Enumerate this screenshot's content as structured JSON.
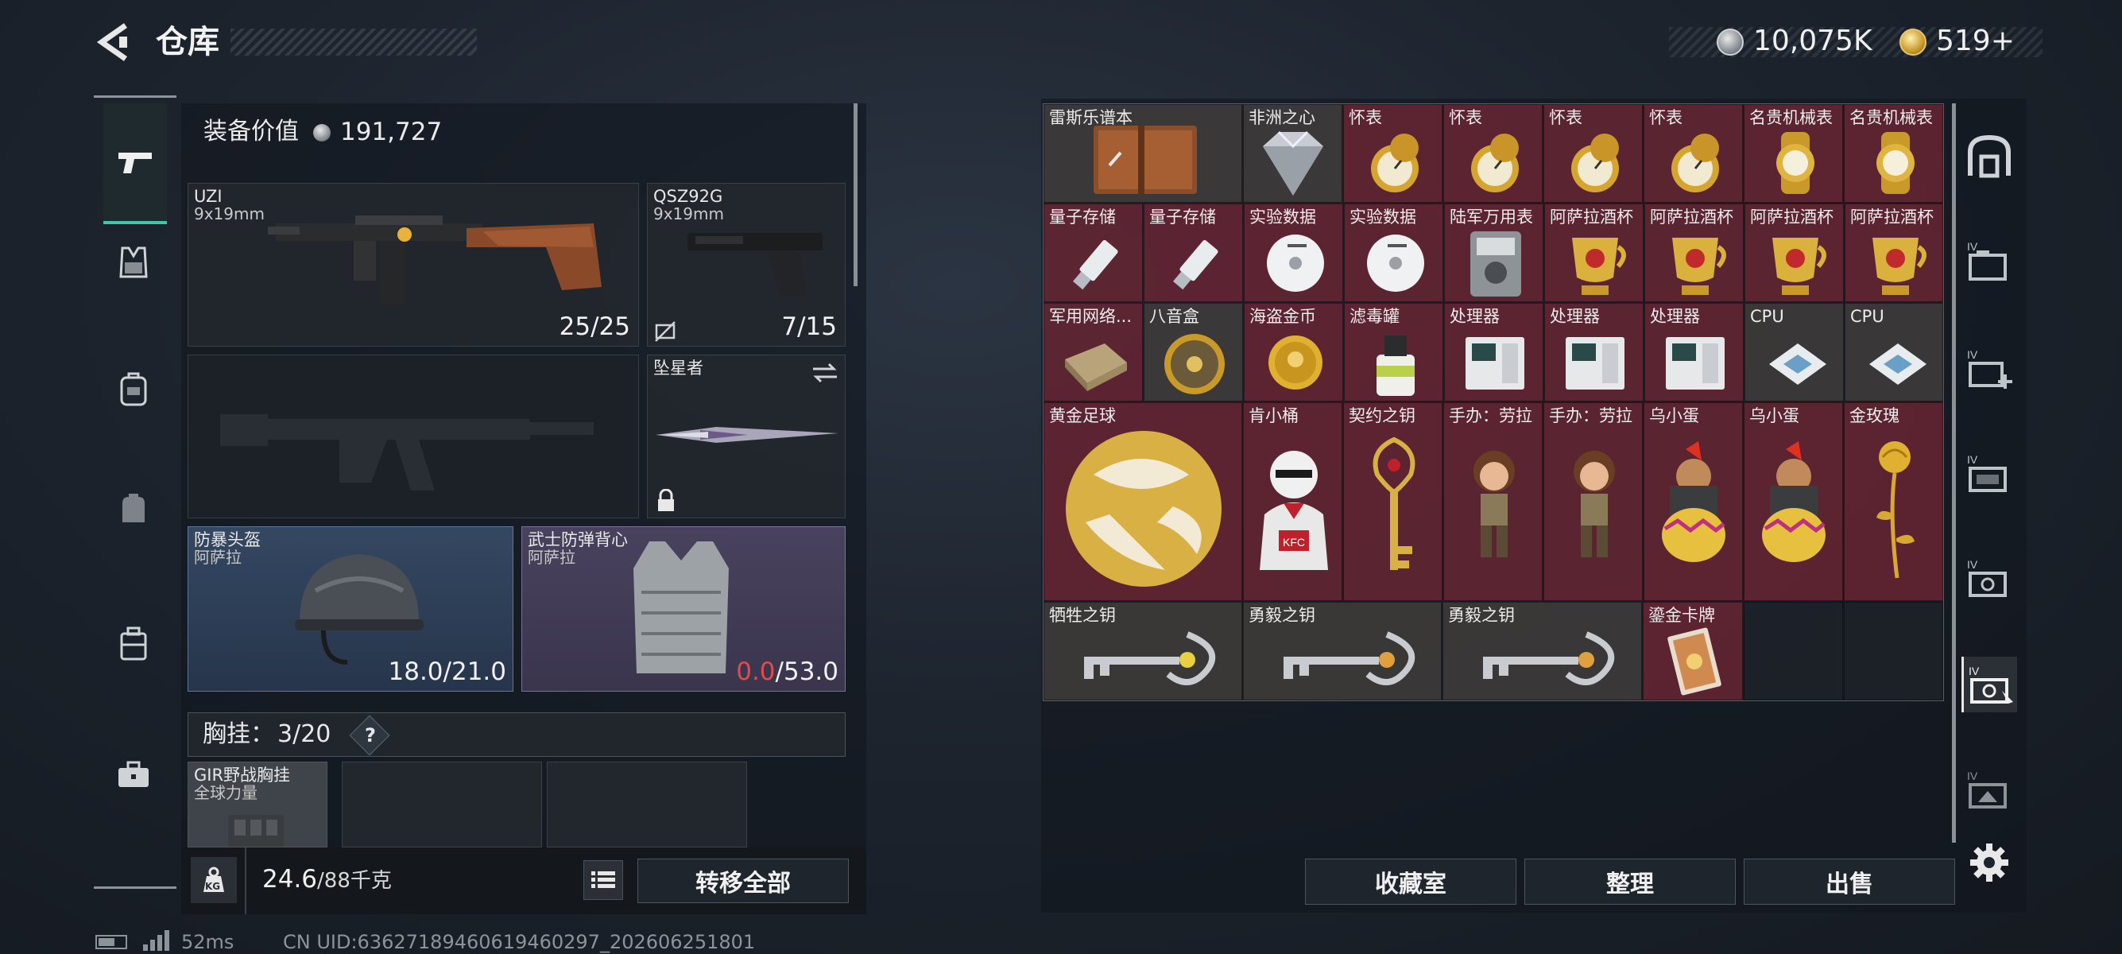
{
  "header": {
    "title": "仓库",
    "currency_silver": "10,075K",
    "currency_gold": "519+",
    "plus": "+"
  },
  "left": {
    "equip_value_label": "装备价值",
    "equip_value": "191,727",
    "primary": {
      "name": "UZI",
      "ammo": "9x19mm",
      "count": "25/25"
    },
    "sidearm": {
      "name": "QSZ92G",
      "ammo": "9x19mm",
      "count": "7/15"
    },
    "melee": {
      "name": "坠星者"
    },
    "helmet": {
      "name": "防暴头盔",
      "brand": "阿萨拉",
      "dur_cur": "18.0",
      "dur_max": "/21.0"
    },
    "armor": {
      "name": "武士防弹背心",
      "brand": "阿萨拉",
      "dur_cur": "0.0",
      "dur_max": "/53.0"
    },
    "chest": {
      "label": "胸挂：",
      "value": "3/20",
      "help": "?"
    },
    "rig": {
      "name": "GIR野战胸挂",
      "sub": "全球力量"
    },
    "weight": {
      "value": "24.6",
      "max": "/88千克",
      "badge": "KG"
    },
    "transfer_all": "转移全部"
  },
  "items": [
    {
      "name": "雷斯乐谱本"
    },
    {
      "name": "非洲之心"
    },
    {
      "name": "怀表"
    },
    {
      "name": "怀表"
    },
    {
      "name": "怀表"
    },
    {
      "name": "怀表"
    },
    {
      "name": "名贵机械表"
    },
    {
      "name": "名贵机械表"
    },
    {
      "name": "量子存储"
    },
    {
      "name": "量子存储"
    },
    {
      "name": "实验数据"
    },
    {
      "name": "实验数据"
    },
    {
      "name": "陆军万用表"
    },
    {
      "name": "阿萨拉酒杯"
    },
    {
      "name": "阿萨拉酒杯"
    },
    {
      "name": "阿萨拉酒杯"
    },
    {
      "name": "阿萨拉酒杯"
    },
    {
      "name": "军用网络..."
    },
    {
      "name": "八音盒"
    },
    {
      "name": "海盗金币"
    },
    {
      "name": "滤毒罐"
    },
    {
      "name": "处理器"
    },
    {
      "name": "处理器"
    },
    {
      "name": "处理器"
    },
    {
      "name": "CPU"
    },
    {
      "name": "CPU"
    },
    {
      "name": "黄金足球"
    },
    {
      "name": "肯小桶"
    },
    {
      "name": "契约之钥"
    },
    {
      "name": "手办：劳拉"
    },
    {
      "name": "手办：劳拉"
    },
    {
      "name": "乌小蛋"
    },
    {
      "name": "乌小蛋"
    },
    {
      "name": "金玫瑰"
    },
    {
      "name": "牺牲之钥"
    },
    {
      "name": "勇毅之钥"
    },
    {
      "name": "勇毅之钥"
    },
    {
      "name": "鎏金卡牌"
    }
  ],
  "kfc_text": "KFC",
  "actions": {
    "collection": "收藏室",
    "sort": "整理",
    "sell": "出售"
  },
  "status": {
    "ping": "52ms",
    "uid": "CN UID:63627189460619460297_202606251801"
  }
}
